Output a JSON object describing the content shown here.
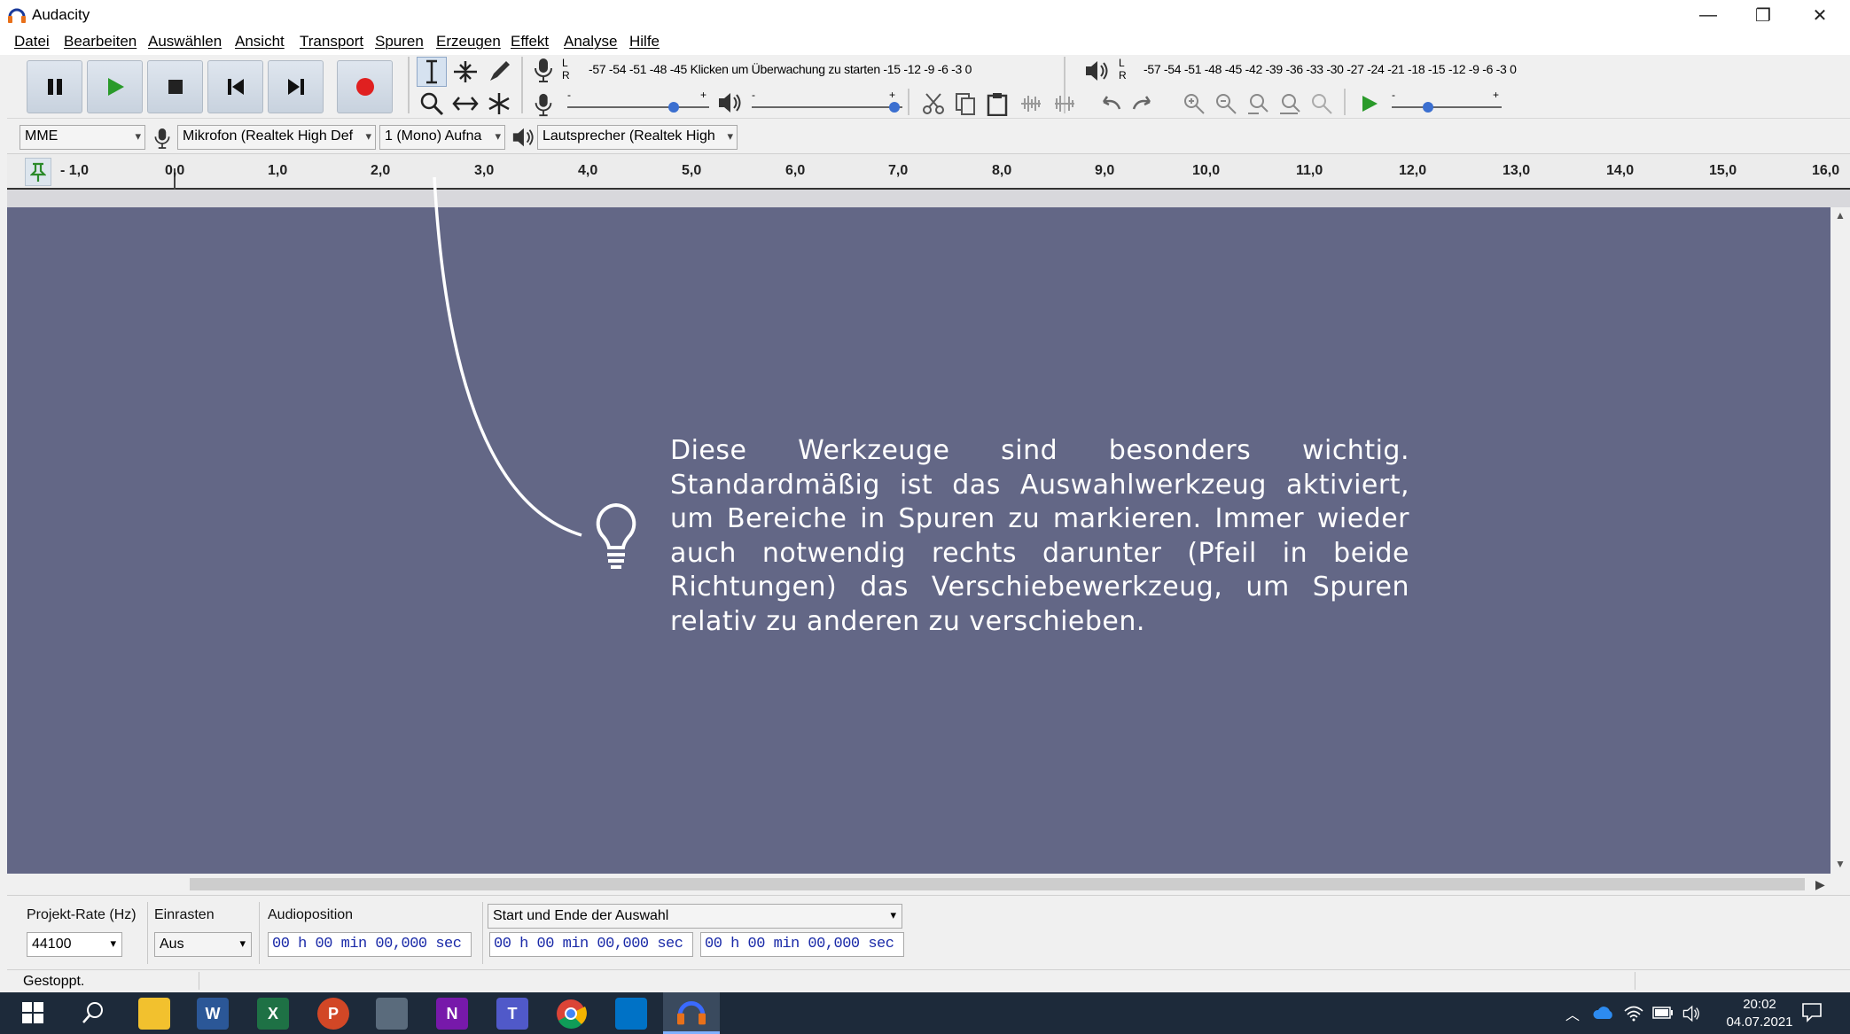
{
  "window": {
    "title": "Audacity",
    "minimize": "—",
    "restore": "❐",
    "close": "✕"
  },
  "menu": [
    "Datei",
    "Bearbeiten",
    "Auswählen",
    "Ansicht",
    "Transport",
    "Spuren",
    "Erzeugen",
    "Effekt",
    "Analyse",
    "Hilfe"
  ],
  "meters": {
    "record_lr": "L\nR",
    "record_scale": "-57 -54 -51 -48 -45 Klicken um Überwachung zu starten -15 -12 -9 -6 -3 0",
    "play_scale": "-57 -54 -51 -48 -45 -42 -39 -36 -33 -30 -27 -24 -21 -18 -15 -12 -9 -6 -3 0",
    "minus": "-",
    "plus": "+"
  },
  "devices": {
    "host": "MME",
    "mic": "Mikrofon (Realtek High Def",
    "channels": "1 (Mono) Aufna",
    "speaker": "Lautsprecher (Realtek High"
  },
  "ruler": {
    "labels": [
      "- 1,0",
      "0,0",
      "1,0",
      "2,0",
      "3,0",
      "4,0",
      "5,0",
      "6,0",
      "7,0",
      "8,0",
      "9,0",
      "10,0",
      "11,0",
      "12,0",
      "13,0",
      "14,0",
      "15,0",
      "16,0"
    ]
  },
  "callout": {
    "text": "Diese Werkzeuge sind besonders wichtig. Standardmäßig ist das Auswahlwerkzeug aktiviert, um Bereiche in Spuren zu markieren. Immer wieder auch notwendig rechts darunter (Pfeil in beide Richtungen) das Verschiebewerkzeug, um Spuren relativ zu anderen zu verschieben."
  },
  "selection_toolbar": {
    "rate_label": "Projekt-Rate (Hz)",
    "rate_value": "44100",
    "snap_label": "Einrasten",
    "snap_value": "Aus",
    "audiopos_label": "Audioposition",
    "audiopos_value": "00 h 00 min 00,000 sec",
    "selection_mode": "Start und Ende der Auswahl",
    "sel_start": "00 h 00 min 00,000 sec",
    "sel_end": "00 h 00 min 00,000 sec"
  },
  "status": {
    "text": "Gestoppt."
  },
  "taskbar": {
    "apps": [
      "W",
      "X",
      "P",
      "N",
      "T"
    ],
    "time": "20:02",
    "date": "04.07.2021"
  },
  "colors": {
    "track_bg": "#636786",
    "accent_record": "#e02020",
    "play_green": "#2a9a2a"
  }
}
